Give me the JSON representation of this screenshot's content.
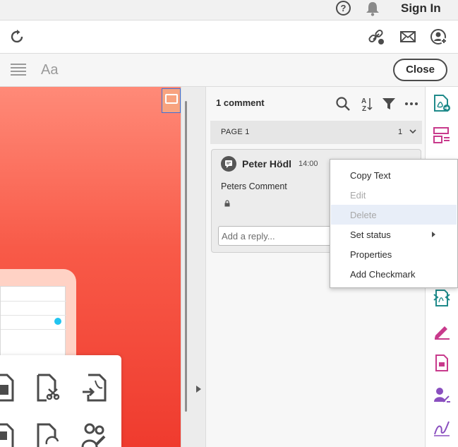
{
  "topbar": {
    "help_glyph": "?",
    "signin_label": "Sign In"
  },
  "toolbar3": {
    "text_tool_label": "Aa",
    "close_label": "Close"
  },
  "comments": {
    "count_label": "1 comment",
    "sort_icon_text": "A Z",
    "page_label": "PAGE 1",
    "page_count": "1",
    "comment": {
      "author": "Peter Hödl",
      "time": "14:00",
      "body": "Peters Comment"
    },
    "reply_placeholder": "Add a reply..."
  },
  "context_menu": {
    "items": [
      {
        "label": "Copy Text",
        "enabled": true
      },
      {
        "label": "Edit",
        "enabled": false
      },
      {
        "label": "Delete",
        "enabled": false
      },
      {
        "label": "Set status",
        "enabled": true
      },
      {
        "label": "Properties",
        "enabled": true
      },
      {
        "label": "Add Checkmark",
        "enabled": true
      }
    ]
  },
  "colors": {
    "accent_teal": "#1f8a8a",
    "accent_pink": "#c83a8c",
    "accent_purple": "#8a4fbf",
    "doc_red": "#f04535"
  }
}
